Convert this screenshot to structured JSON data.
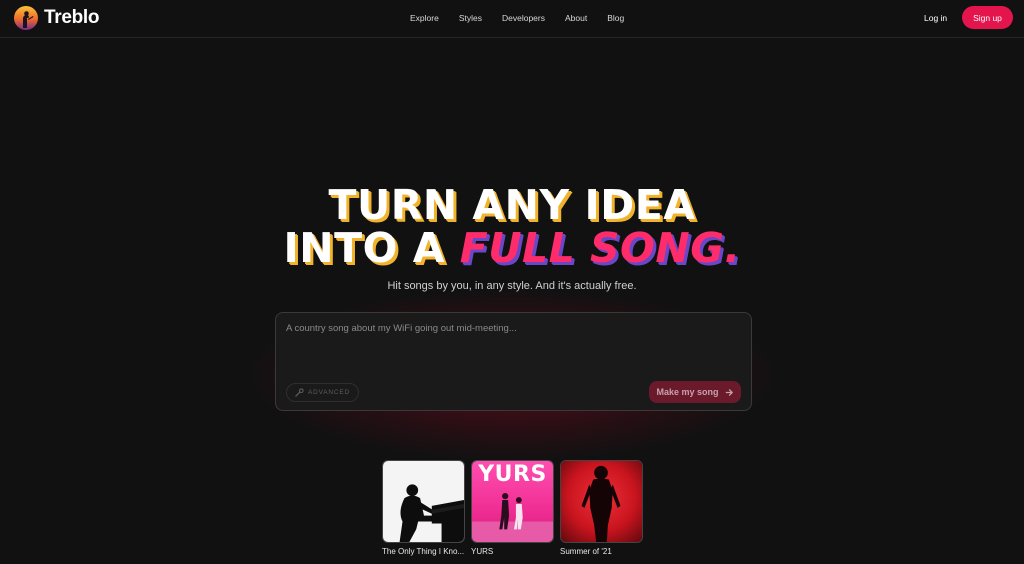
{
  "nav": {
    "logo_text": "Treblo",
    "links": [
      "Explore",
      "Styles",
      "Developers",
      "About",
      "Blog"
    ],
    "login": "Log in",
    "signup": "Sign up"
  },
  "hero": {
    "line1": "TURN ANY IDEA",
    "line2_prefix": "INTO A ",
    "line2_accent": "FULL SONG.",
    "subtitle": "Hit songs by you, in any style. And it's actually free."
  },
  "prompt": {
    "placeholder": "A country song about my WiFi going out mid-meeting...",
    "value": "",
    "advanced_label": "ADVANCED",
    "submit_label": "Make my song"
  },
  "songs": [
    {
      "title": "The Only Thing I Kno...",
      "cover_icon": "piano-silhouette"
    },
    {
      "title": "YURS",
      "cover_text": "YURS",
      "cover_icon": "couple-pink"
    },
    {
      "title": "Summer of '21",
      "cover_icon": "red-silhouette"
    }
  ],
  "colors": {
    "background": "#111111",
    "accent": "#e4144c",
    "headline_shadow": "#f2b32c",
    "accent_shadow": "#6a47c8"
  }
}
